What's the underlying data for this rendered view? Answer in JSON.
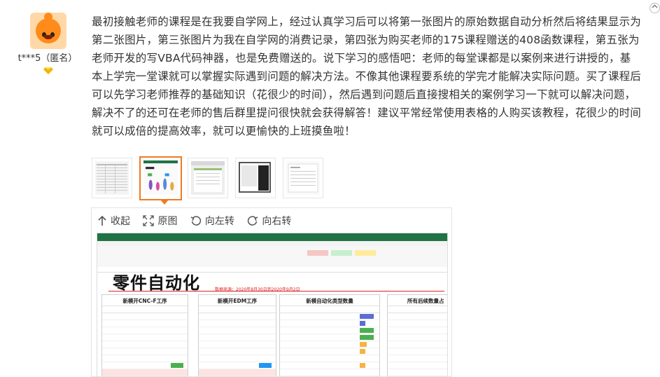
{
  "user": {
    "name": "t***5（匿名）"
  },
  "review": {
    "text": "最初接触老师的课程是在我要自学网上，经过认真学习后可以将第一张图片的原始数据自动分析然后将结果显示为第二张图片，第三张图片为我在自学网的消费记录，第四张为购买老师的175课程赠送的408函数课程，第五张为老师开发的写VBA代码神器，也是免费赠送的。说下学习的感悟吧：老师的每堂课都是以案例来进行讲授的，基本上学完一堂课就可以掌握实际遇到问题的解决方法。不像其他课程要系统的学完才能解决实际问题。买了课程后可以先学习老师推荐的基础知识（花很少的时间），然后遇到问题后直接搜相关的案例学习一下就可以解决问题，解决不了的还可在老师的售后群里提问很快就会获得解答！建议平常经常使用表格的人购买该教程，花很少的时间就可以成倍的提高效率，就可以更愉快的上班摸鱼啦！"
  },
  "thumbnails": {
    "count": 5,
    "selected_index": 1
  },
  "viewer": {
    "collapse_label": "收起",
    "original_label": "原图",
    "rotate_left_label": "向左转",
    "rotate_right_label": "向右转"
  },
  "preview_sheet": {
    "title": "零件自动化",
    "subtitle": "数据来源：2020年8月30日到2020年9月2日",
    "tables": [
      {
        "header": "新模开CNC-F工序"
      },
      {
        "header": "新模开EDM工序"
      },
      {
        "header": "新模自动化类型数量"
      },
      {
        "header": "所有后续数量占"
      }
    ]
  },
  "colors": {
    "accent": "#f07a22",
    "excel_green": "#217346",
    "red": "#e02020"
  }
}
